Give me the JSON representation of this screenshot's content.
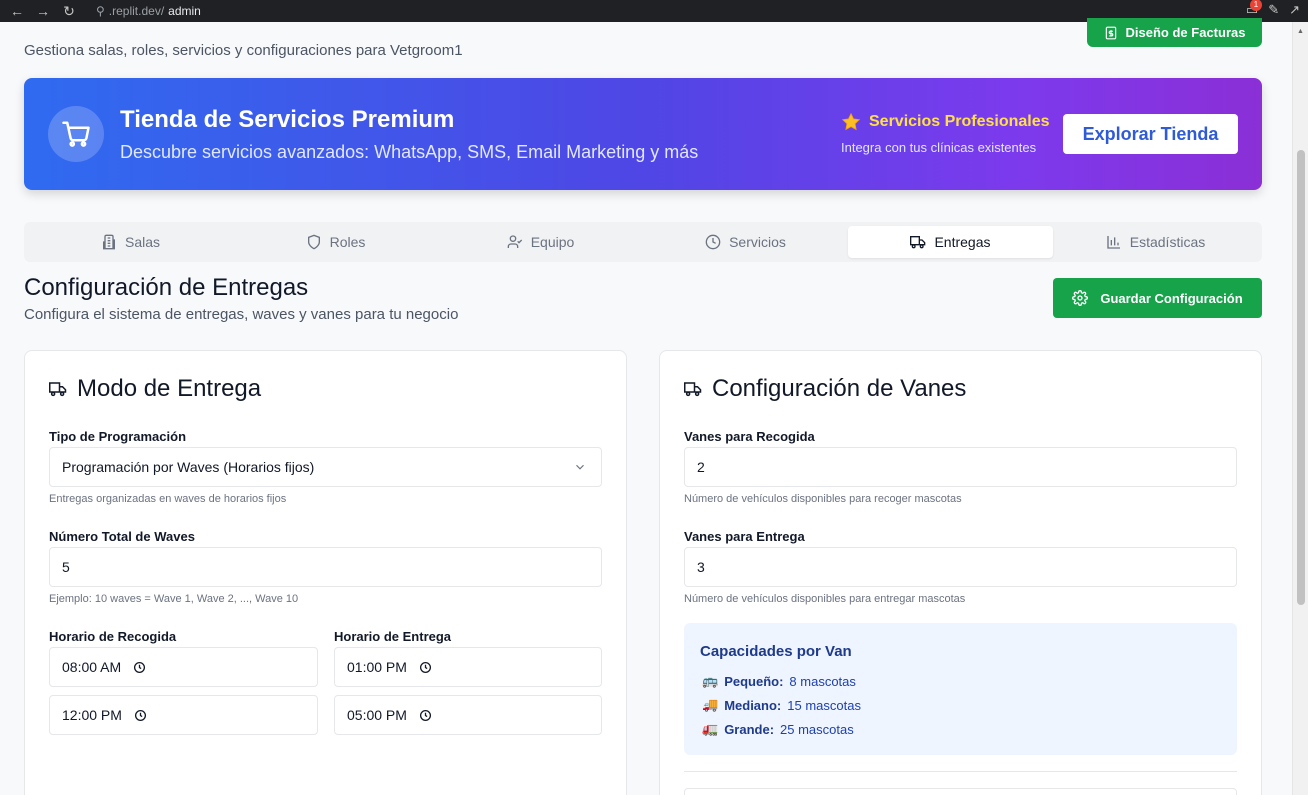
{
  "browser": {
    "url_host": ".replit.dev/",
    "url_path": "admin",
    "notification_count": "1"
  },
  "header": {
    "subtitle": "Gestiona salas, roles, servicios y configuraciones para Vetgroom1",
    "invoice_button": "Diseño de Facturas"
  },
  "banner": {
    "title": "Tienda de Servicios Premium",
    "description": "Descubre servicios avanzados: WhatsApp, SMS, Email Marketing y más",
    "pro_label": "Servicios Profesionales",
    "pro_sub": "Integra con tus clínicas existentes",
    "explore_button": "Explorar Tienda"
  },
  "tabs": [
    {
      "label": "Salas",
      "icon": "building-icon"
    },
    {
      "label": "Roles",
      "icon": "shield-icon"
    },
    {
      "label": "Equipo",
      "icon": "user-check-icon"
    },
    {
      "label": "Servicios",
      "icon": "clock-icon"
    },
    {
      "label": "Entregas",
      "icon": "truck-icon",
      "active": true
    },
    {
      "label": "Estadísticas",
      "icon": "bar-chart-icon"
    }
  ],
  "section": {
    "title": "Configuración de Entregas",
    "subtitle": "Configura el sistema de entregas, waves y vanes para tu negocio",
    "save_button": "Guardar Configuración"
  },
  "delivery_mode": {
    "title": "Modo de Entrega",
    "schedule_label": "Tipo de Programación",
    "schedule_value": "Programación por Waves (Horarios fijos)",
    "schedule_help": "Entregas organizadas en waves de horarios fijos",
    "waves_label": "Número Total de Waves",
    "waves_value": "5",
    "waves_help": "Ejemplo: 10 waves = Wave 1, Wave 2, ..., Wave 10",
    "pickup_label": "Horario de Recogida",
    "pickup_start": "08:00 AM",
    "pickup_end": "12:00 PM",
    "delivery_label": "Horario de Entrega",
    "delivery_start": "01:00 PM",
    "delivery_end": "05:00 PM"
  },
  "vans": {
    "title": "Configuración de Vanes",
    "pickup_label": "Vanes para Recogida",
    "pickup_value": "2",
    "pickup_help": "Número de vehículos disponibles para recoger mascotas",
    "delivery_label": "Vanes para Entrega",
    "delivery_value": "3",
    "delivery_help": "Número de vehículos disponibles para entregar mascotas",
    "capacity_title": "Capacidades por Van",
    "capacities": [
      {
        "name": "Pequeño:",
        "value": "8 mascotas",
        "icon": "bus-icon"
      },
      {
        "name": "Mediano:",
        "value": "15 mascotas",
        "icon": "delivery-truck-icon"
      },
      {
        "name": "Grande:",
        "value": "25 mascotas",
        "icon": "articulated-truck-icon"
      }
    ]
  },
  "colors": {
    "primary_green": "#16a34a",
    "banner_start": "#2f6bf0",
    "banner_end": "#8b2fd6",
    "accent_yellow": "#fde047"
  }
}
